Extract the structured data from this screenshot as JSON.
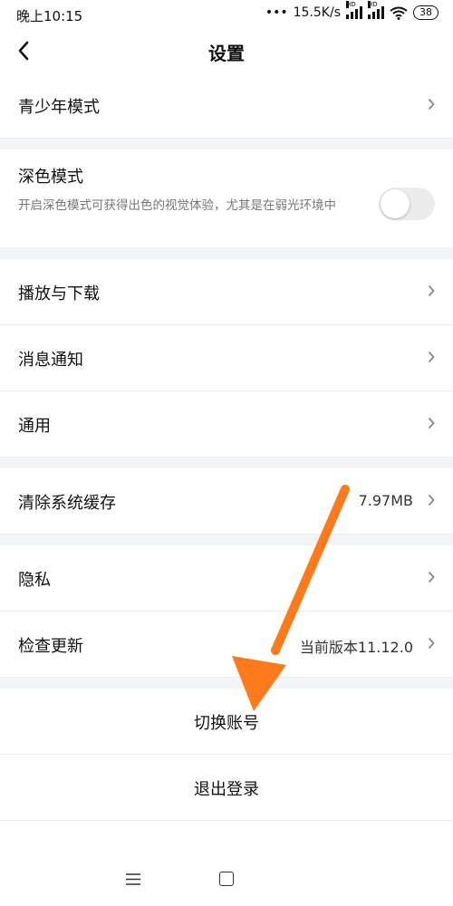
{
  "status_bar": {
    "time": "晚上10:15",
    "speed": "15.5K/s",
    "hd1": "HD",
    "hd2": "HD",
    "battery": "38"
  },
  "header": {
    "title": "设置"
  },
  "settings": {
    "teen_mode": "青少年模式",
    "dark_mode": {
      "label": "深色模式",
      "description": "开启深色模式可获得出色的视觉体验，尤其是在弱光环境中",
      "enabled": false
    },
    "playback_download": "播放与下载",
    "notifications": "消息通知",
    "general": "通用",
    "clear_cache": {
      "label": "清除系统缓存",
      "value": "7.97MB"
    },
    "privacy": "隐私",
    "check_update": {
      "label": "检查更新",
      "value": "当前版本11.12.0"
    }
  },
  "actions": {
    "switch_account": "切换账号",
    "logout": "退出登录"
  },
  "colors": {
    "annotation_arrow": "#ff7a1a",
    "section_gap": "#f3f4f6",
    "toggle_off": "#ececec"
  },
  "icons": [
    "back-chevron-icon",
    "chevron-right-icon",
    "wifi-icon",
    "signal-icon",
    "battery-icon",
    "menu-icon",
    "home-icon",
    "annotation-arrow"
  ]
}
